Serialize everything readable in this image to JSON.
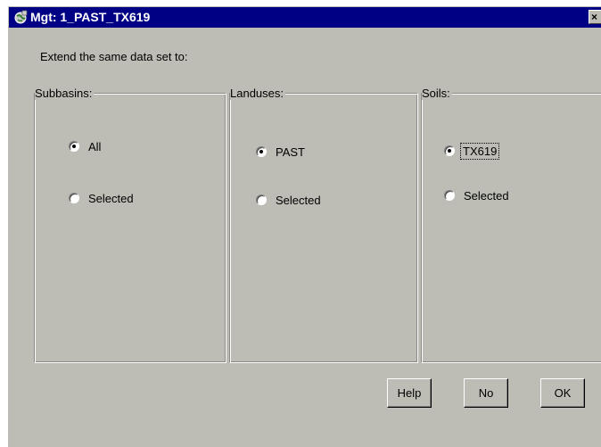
{
  "window": {
    "title": "Mgt: 1_PAST_TX619",
    "close_glyph": "×"
  },
  "instruction": "Extend the same data set to:",
  "groups": {
    "subbasins": {
      "label": "Subbasins:",
      "options": [
        "All",
        "Selected"
      ],
      "selected": "All"
    },
    "landuses": {
      "label": "Landuses:",
      "options": [
        "PAST",
        "Selected"
      ],
      "selected": "PAST"
    },
    "soils": {
      "label": "Soils:",
      "options": [
        "TX619",
        "Selected"
      ],
      "selected": "TX619"
    }
  },
  "buttons": {
    "help": "Help",
    "no": "No",
    "ok": "OK"
  },
  "colors": {
    "titlebar": "#000084",
    "face": "#bdbdb5"
  },
  "icons": {
    "title": "app-globe-icon",
    "close": "close-icon"
  }
}
